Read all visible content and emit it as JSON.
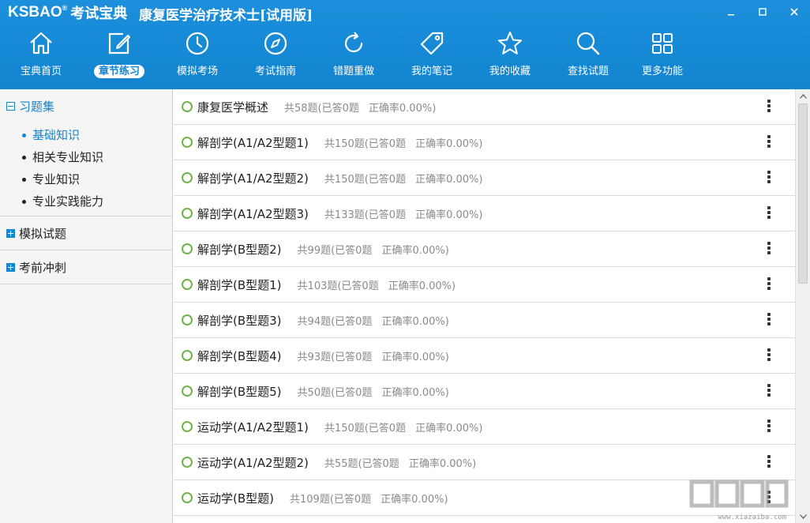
{
  "brand": {
    "logo": "KSBAO",
    "logo_mark": "®",
    "name_cn": "考试宝典"
  },
  "window": {
    "title": "康复医学治疗技术士[试用版]"
  },
  "toolbar": {
    "items": [
      {
        "label": "宝典首页",
        "icon": "home-icon"
      },
      {
        "label": "章节练习",
        "icon": "edit-icon",
        "active": true
      },
      {
        "label": "模拟考场",
        "icon": "clock-icon"
      },
      {
        "label": "考试指南",
        "icon": "compass-icon"
      },
      {
        "label": "错题重做",
        "icon": "refresh-icon"
      },
      {
        "label": "我的笔记",
        "icon": "tag-icon"
      },
      {
        "label": "我的收藏",
        "icon": "star-icon"
      },
      {
        "label": "查找试题",
        "icon": "search-icon"
      },
      {
        "label": "更多功能",
        "icon": "grid-icon"
      }
    ]
  },
  "sidebar": {
    "sections": [
      {
        "label": "习题集",
        "expanded": true,
        "items": [
          {
            "label": "基础知识",
            "active": true
          },
          {
            "label": "相关专业知识"
          },
          {
            "label": "专业知识"
          },
          {
            "label": "专业实践能力"
          }
        ]
      },
      {
        "label": "模拟试题",
        "expanded": false
      },
      {
        "label": "考前冲刺",
        "expanded": false
      }
    ]
  },
  "chapters": [
    {
      "title": "康复医学概述",
      "stats": "共58题(已答0题",
      "accuracy": "正确率0.00%)"
    },
    {
      "title": "解剖学(A1/A2型题1)",
      "stats": "共150题(已答0题",
      "accuracy": "正确率0.00%)"
    },
    {
      "title": "解剖学(A1/A2型题2)",
      "stats": "共150题(已答0题",
      "accuracy": "正确率0.00%)"
    },
    {
      "title": "解剖学(A1/A2型题3)",
      "stats": "共133题(已答0题",
      "accuracy": "正确率0.00%)"
    },
    {
      "title": "解剖学(B型题2)",
      "stats": "共99题(已答0题",
      "accuracy": "正确率0.00%)"
    },
    {
      "title": "解剖学(B型题1)",
      "stats": "共103题(已答0题",
      "accuracy": "正确率0.00%)"
    },
    {
      "title": "解剖学(B型题3)",
      "stats": "共94题(已答0题",
      "accuracy": "正确率0.00%)"
    },
    {
      "title": "解剖学(B型题4)",
      "stats": "共93题(已答0题",
      "accuracy": "正确率0.00%)"
    },
    {
      "title": "解剖学(B型题5)",
      "stats": "共50题(已答0题",
      "accuracy": "正确率0.00%)"
    },
    {
      "title": "运动学(A1/A2型题1)",
      "stats": "共150题(已答0题",
      "accuracy": "正确率0.00%)"
    },
    {
      "title": "运动学(A1/A2型题2)",
      "stats": "共55题(已答0题",
      "accuracy": "正确率0.00%)"
    },
    {
      "title": "运动学(B型题)",
      "stats": "共109题(已答0题",
      "accuracy": "正确率0.00%)"
    }
  ],
  "watermark": {
    "text": "www.xiazaiba.com"
  },
  "colors": {
    "accent": "#1485d2",
    "toolbar_bg": "#168ad6",
    "circle": "#6fb24a"
  }
}
